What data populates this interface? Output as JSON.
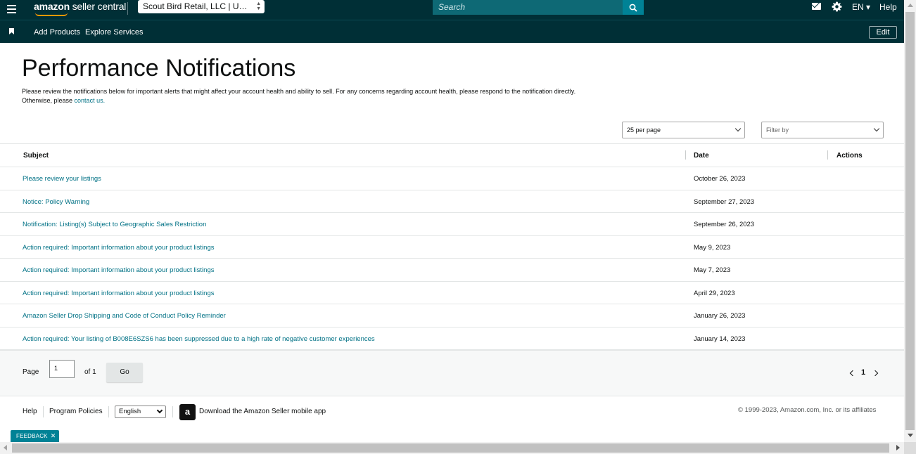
{
  "header": {
    "logo_bold": "amazon",
    "logo_thin": " seller central",
    "account": "Scout Bird Retail, LLC | Unit...",
    "search_placeholder": "Search",
    "language": "EN",
    "help": "Help"
  },
  "nav": {
    "items": [
      "Add Products",
      "Explore Services"
    ],
    "edit": "Edit"
  },
  "page": {
    "title": "Performance Notifications",
    "intro": "Please review the notifications below for important alerts that might affect your account health and ability to sell. For any concerns regarding account health, please respond to the notification directly. Otherwise, please ",
    "contact_link": "contact us.",
    "per_page": "25 per page",
    "filter_placeholder": "Filter by"
  },
  "table": {
    "columns": [
      "Subject",
      "Date",
      "Actions"
    ],
    "rows": [
      {
        "subject": "Please review your listings",
        "date": "October 26, 2023"
      },
      {
        "subject": "Notice: Policy Warning",
        "date": "September 27, 2023"
      },
      {
        "subject": "Notification: Listing(s) Subject to Geographic Sales Restriction",
        "date": "September 26, 2023"
      },
      {
        "subject": "Action required: Important information about your product listings",
        "date": "May 9, 2023"
      },
      {
        "subject": "Action required: Important information about your product listings",
        "date": "May 7, 2023"
      },
      {
        "subject": "Action required: Important information about your product listings",
        "date": "April 29, 2023"
      },
      {
        "subject": "Amazon Seller Drop Shipping and Code of Conduct Policy Reminder",
        "date": "January 26, 2023"
      },
      {
        "subject": "Action required: Your listing of B008E6SZS6 has been suppressed due to a high rate of negative customer experiences",
        "date": "January 14, 2023"
      }
    ]
  },
  "pager": {
    "page_label": "Page",
    "page_value": "1",
    "of_label": "of 1",
    "go": "Go",
    "current": "1"
  },
  "footer": {
    "help": "Help",
    "policies": "Program Policies",
    "language": "English",
    "app_icon_letter": "a",
    "app_link": "Download the Amazon Seller mobile app",
    "copyright": "© 1999-2023, Amazon.com, Inc. or its affiliates",
    "feedback": "FEEDBACK"
  },
  "colors": {
    "header_bg": "#002f36",
    "link": "#007185",
    "accent": "#008296"
  }
}
